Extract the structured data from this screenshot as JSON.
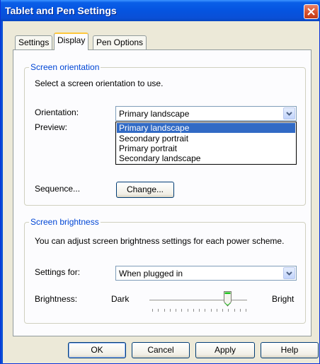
{
  "window": {
    "title": "Tablet and Pen Settings"
  },
  "tabs": [
    {
      "label": "Settings",
      "active": false
    },
    {
      "label": "Display",
      "active": true
    },
    {
      "label": "Pen Options",
      "active": false
    }
  ],
  "orientation": {
    "group_title": "Screen orientation",
    "instruction": "Select a screen orientation to use.",
    "orientation_label": "Orientation:",
    "orientation_value": "Primary landscape",
    "options": [
      "Primary landscape",
      "Secondary portrait",
      "Primary portrait",
      "Secondary landscape"
    ],
    "preview_label": "Preview:",
    "sequence_label": "Sequence...",
    "change_button": "Change..."
  },
  "brightness": {
    "group_title": "Screen brightness",
    "instruction": "You can adjust screen brightness settings for each power scheme.",
    "settings_for_label": "Settings for:",
    "settings_for_value": "When plugged in",
    "brightness_label": "Brightness:",
    "dark_label": "Dark",
    "bright_label": "Bright",
    "level": 0.8
  },
  "buttons": {
    "ok": "OK",
    "cancel": "Cancel",
    "apply": "Apply",
    "help": "Help"
  },
  "colors": {
    "title_bar": "#0554e0",
    "group_title": "#0046d5",
    "selection": "#316ac5",
    "close": "#d6512d"
  },
  "icons": {
    "close": "close-icon",
    "combo_arrow": "chevron-down-icon",
    "slider_thumb": "slider-thumb-icon"
  }
}
